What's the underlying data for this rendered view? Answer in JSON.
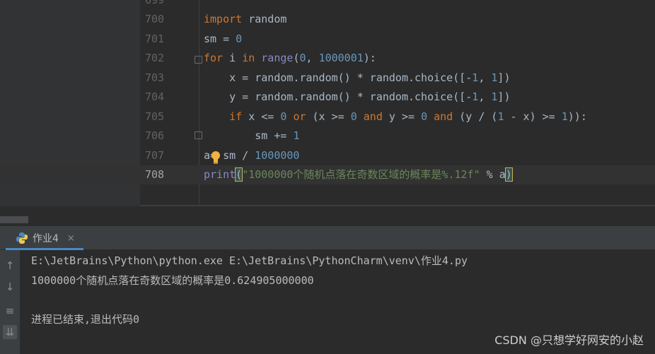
{
  "editor": {
    "partial_line_number": "699",
    "lines": [
      {
        "num": "700",
        "code": [
          {
            "t": "kw",
            "v": "import"
          },
          {
            "t": "p",
            "v": " random"
          }
        ]
      },
      {
        "num": "701",
        "code": [
          {
            "t": "p",
            "v": "sm = "
          },
          {
            "t": "num",
            "v": "0"
          }
        ]
      },
      {
        "num": "702",
        "code": [
          {
            "t": "kw",
            "v": "for"
          },
          {
            "t": "p",
            "v": " i "
          },
          {
            "t": "kw",
            "v": "in"
          },
          {
            "t": "p",
            "v": " "
          },
          {
            "t": "bi",
            "v": "range"
          },
          {
            "t": "p",
            "v": "("
          },
          {
            "t": "num",
            "v": "0"
          },
          {
            "t": "p",
            "v": ", "
          },
          {
            "t": "num",
            "v": "1000001"
          },
          {
            "t": "p",
            "v": "):"
          }
        ]
      },
      {
        "num": "703",
        "code": [
          {
            "t": "p",
            "v": "    x = random.random() * random.choice([-"
          },
          {
            "t": "num",
            "v": "1"
          },
          {
            "t": "p",
            "v": ", "
          },
          {
            "t": "num",
            "v": "1"
          },
          {
            "t": "p",
            "v": "])"
          }
        ]
      },
      {
        "num": "704",
        "code": [
          {
            "t": "p",
            "v": "    y = random.random() * random.choice([-"
          },
          {
            "t": "num",
            "v": "1"
          },
          {
            "t": "p",
            "v": ", "
          },
          {
            "t": "num",
            "v": "1"
          },
          {
            "t": "p",
            "v": "])"
          }
        ]
      },
      {
        "num": "705",
        "code": [
          {
            "t": "p",
            "v": "    "
          },
          {
            "t": "kw",
            "v": "if"
          },
          {
            "t": "p",
            "v": " x <= "
          },
          {
            "t": "num",
            "v": "0"
          },
          {
            "t": "p",
            "v": " "
          },
          {
            "t": "kw",
            "v": "or"
          },
          {
            "t": "p",
            "v": " (x >= "
          },
          {
            "t": "num",
            "v": "0"
          },
          {
            "t": "p",
            "v": " "
          },
          {
            "t": "kw",
            "v": "and"
          },
          {
            "t": "p",
            "v": " y >= "
          },
          {
            "t": "num",
            "v": "0"
          },
          {
            "t": "p",
            "v": " "
          },
          {
            "t": "kw",
            "v": "and"
          },
          {
            "t": "p",
            "v": " (y / ("
          },
          {
            "t": "num",
            "v": "1"
          },
          {
            "t": "p",
            "v": " - x) >= "
          },
          {
            "t": "num",
            "v": "1"
          },
          {
            "t": "p",
            "v": ")):"
          }
        ]
      },
      {
        "num": "706",
        "code": [
          {
            "t": "p",
            "v": "        sm += "
          },
          {
            "t": "num",
            "v": "1"
          }
        ]
      },
      {
        "num": "707",
        "code": [
          {
            "t": "p",
            "v": "a"
          },
          {
            "t": "p",
            "v": "= sm / "
          },
          {
            "t": "num",
            "v": "1000000"
          }
        ]
      },
      {
        "num": "708",
        "code": [
          {
            "t": "bi",
            "v": "print"
          },
          {
            "t": "hl",
            "v": "("
          },
          {
            "t": "str",
            "v": "\"1000000个随机点落在奇数区域的概率是%.12f\""
          },
          {
            "t": "p",
            "v": " % a"
          },
          {
            "t": "hl",
            "v": ")"
          }
        ]
      }
    ]
  },
  "run": {
    "tab_label": "作业4",
    "close": "×",
    "output": [
      "E:\\JetBrains\\Python\\python.exe E:\\JetBrains\\PythonCharm\\venv\\作业4.py",
      "1000000个随机点落在奇数区域的概率是0.624905000000",
      "",
      "进程已结束,退出代码0"
    ]
  },
  "watermark": "CSDN @只想学好网安的小赵",
  "colors": {
    "keyword": "#cc7832",
    "number": "#6897bb",
    "string": "#6a8759",
    "builtin": "#8888c6",
    "text": "#a9b7c6"
  }
}
